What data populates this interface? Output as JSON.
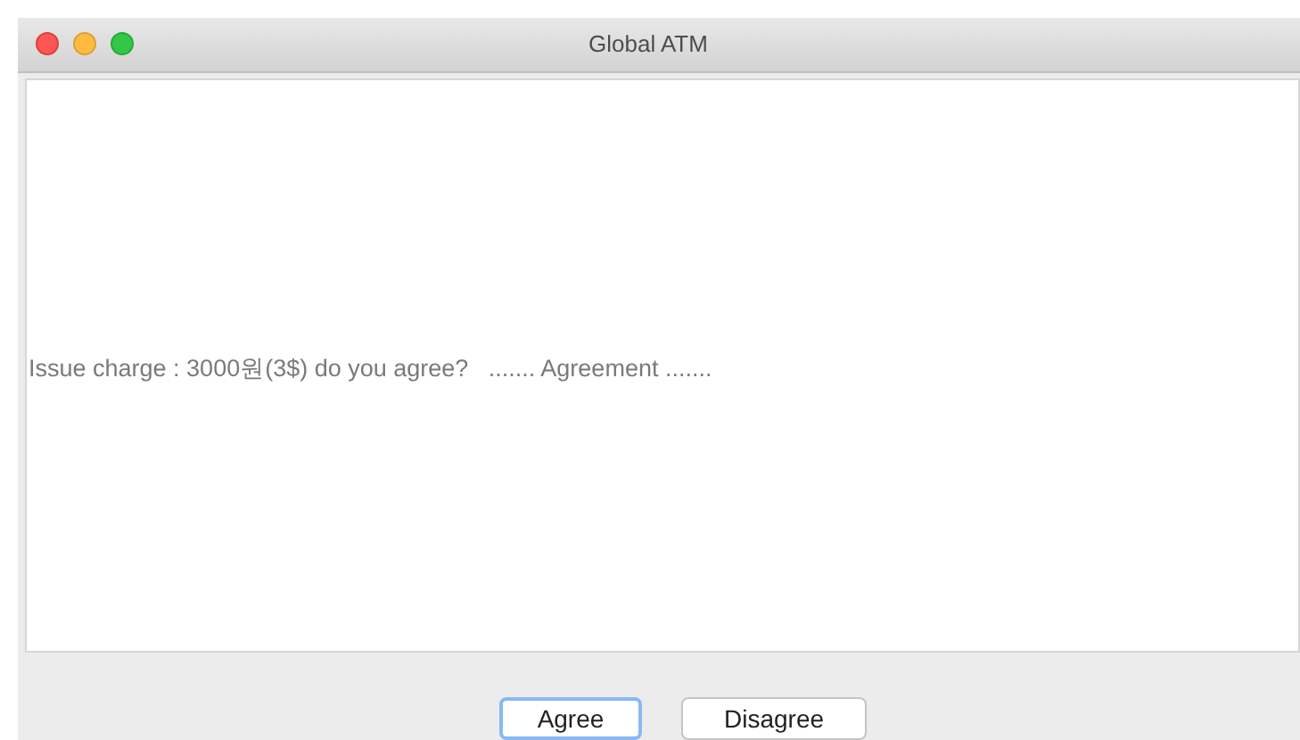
{
  "window": {
    "title": "Global ATM"
  },
  "message": "Issue charge : 3000원(3$) do you agree?   ....... Agreement .......",
  "buttons": [
    {
      "label": "Agree",
      "focused": true
    },
    {
      "label": "Disagree",
      "focused": false
    }
  ]
}
